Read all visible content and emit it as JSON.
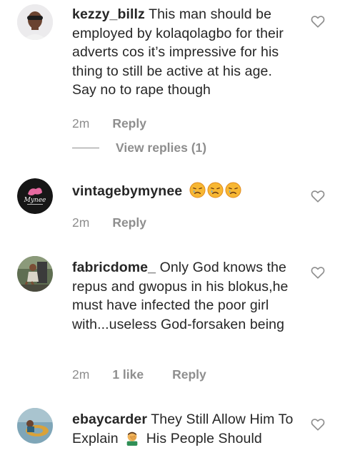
{
  "comments": [
    {
      "username": "kezzy_billz",
      "text": "This man should be employed by kolaqolagbo for their adverts cos it’s impressive for his thing to still be active at his age. Say no to rape though",
      "time": "2m",
      "reply": "Reply",
      "view_replies": "View replies (1)",
      "avatar": "profile-photo"
    },
    {
      "username": "vintagebymynee",
      "emojis": [
        "crying-face",
        "crying-face",
        "crying-face"
      ],
      "time": "2m",
      "reply": "Reply",
      "avatar": "brand-logo",
      "avatar_text": "Mynee"
    },
    {
      "username": "fabricdome_",
      "text": "Only God knows the repus and gwopus in his blokus,he must have infected the poor girl with...useless God-forsaken being",
      "time": "2m",
      "likes": "1 like",
      "reply": "Reply",
      "avatar": "profile-photo"
    },
    {
      "username": "ebaycarder",
      "text_before": "They Still Allow Him To Explain",
      "emoji": "man-facepalming",
      "text_after": "His People Should",
      "avatar": "profile-photo"
    }
  ],
  "colors": {
    "text": "#262626",
    "muted": "#8e8e8e",
    "background": "#ffffff"
  }
}
